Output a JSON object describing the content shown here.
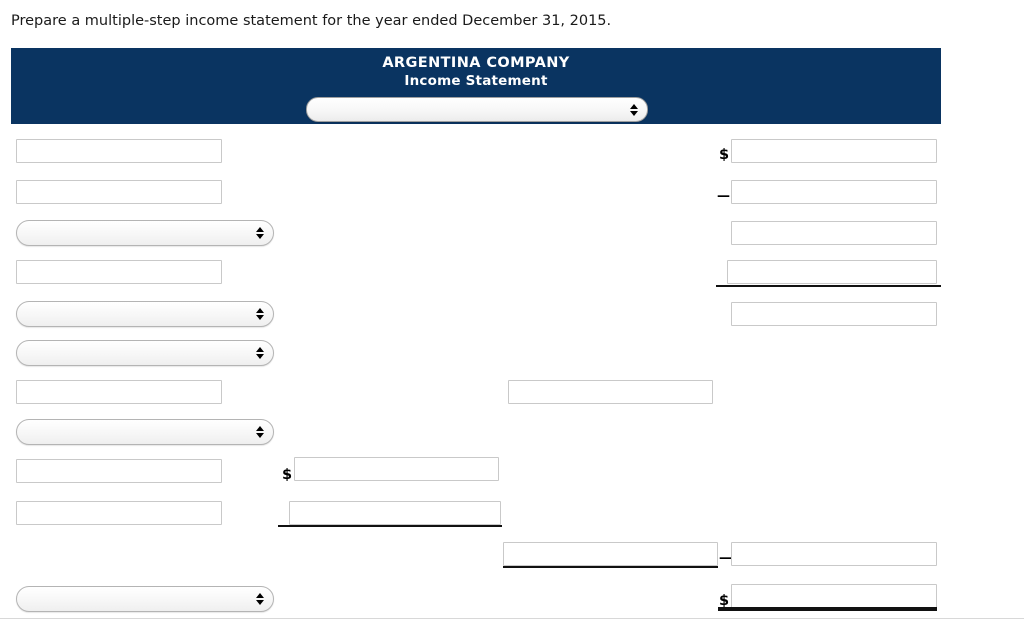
{
  "instruction": "Prepare a multiple-step income statement for the year ended December 31, 2015.",
  "header": {
    "company_name": "ARGENTINA COMPANY",
    "statement_title": "Income Statement",
    "navy_color": "#0a3461",
    "period_select": {
      "value": "",
      "placeholder": "",
      "icon": "stepper-arrows-icon"
    }
  },
  "symbols": {
    "dollar": "$",
    "minus": "—"
  },
  "rows": [
    {
      "id": "row-1",
      "label_field": {
        "type": "text",
        "value": "",
        "placeholder": ""
      },
      "right_amount": {
        "type": "text",
        "value": "",
        "placeholder": "",
        "prefix": "$"
      }
    },
    {
      "id": "row-2",
      "label_field": {
        "type": "text",
        "value": "",
        "placeholder": ""
      },
      "right_amount": {
        "type": "text",
        "value": "",
        "placeholder": "",
        "prefix": "—"
      }
    },
    {
      "id": "row-3",
      "label_field": {
        "type": "select",
        "value": "",
        "placeholder": ""
      },
      "right_amount": {
        "type": "text",
        "value": "",
        "placeholder": "",
        "prefix": ""
      }
    },
    {
      "id": "row-4",
      "label_field": {
        "type": "text",
        "value": "",
        "placeholder": ""
      },
      "right_amount": {
        "type": "text",
        "value": "",
        "placeholder": "",
        "prefix": "",
        "rule": "single"
      }
    },
    {
      "id": "row-5",
      "label_field": {
        "type": "select",
        "value": "",
        "placeholder": ""
      },
      "right_amount": {
        "type": "text",
        "value": "",
        "placeholder": "",
        "prefix": ""
      }
    },
    {
      "id": "row-6",
      "label_field": {
        "type": "select",
        "value": "",
        "placeholder": ""
      }
    },
    {
      "id": "row-7",
      "label_field": {
        "type": "text",
        "value": "",
        "placeholder": ""
      },
      "mid_right_amount": {
        "type": "text",
        "value": "",
        "placeholder": ""
      }
    },
    {
      "id": "row-8",
      "label_field": {
        "type": "select",
        "value": "",
        "placeholder": ""
      }
    },
    {
      "id": "row-9",
      "label_field": {
        "type": "text",
        "value": "",
        "placeholder": ""
      },
      "mid_left_amount": {
        "type": "text",
        "value": "",
        "placeholder": "",
        "prefix": "$"
      }
    },
    {
      "id": "row-10",
      "label_field": {
        "type": "text",
        "value": "",
        "placeholder": ""
      },
      "mid_left_amount": {
        "type": "text",
        "value": "",
        "placeholder": "",
        "prefix": "",
        "rule": "single"
      }
    },
    {
      "id": "row-11",
      "mid_right_amount": {
        "type": "text",
        "value": "",
        "placeholder": "",
        "rule": "single"
      },
      "right_amount": {
        "type": "text",
        "value": "",
        "placeholder": "",
        "prefix": "—"
      }
    },
    {
      "id": "row-12",
      "label_field": {
        "type": "select",
        "value": "",
        "placeholder": ""
      },
      "right_amount": {
        "type": "text",
        "value": "",
        "placeholder": "",
        "prefix": "$",
        "rule": "double"
      }
    }
  ]
}
